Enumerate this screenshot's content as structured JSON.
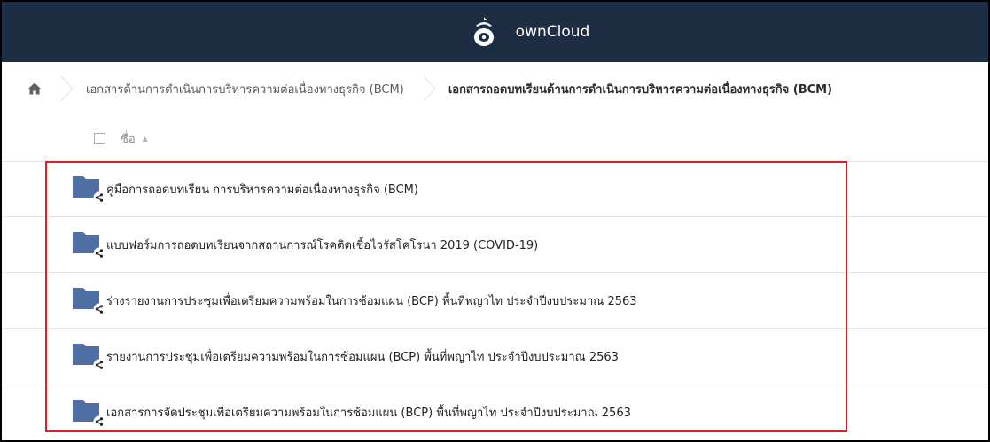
{
  "app": {
    "name": "ownCloud"
  },
  "breadcrumb": {
    "home_icon": "home-icon",
    "items": [
      "เอกสารด้านการดำเนินการบริหารความต่อเนื่องทางธุรกิจ (BCM)",
      "เอกสารถอดบทเรียนด้านการดำเนินการบริหารความต่อเนื่องทางธุรกิจ (BCM)"
    ]
  },
  "file_list": {
    "name_header": "ชื่อ",
    "sort_icon": "sort-ascending-icon",
    "items": [
      {
        "name": "คู่มือการถอดบทเรียน การบริหารความต่อเนื่องทางธุรกิจ (BCM)",
        "icon": "shared-folder-icon"
      },
      {
        "name": "แบบฟอร์มการถอดบทเรียนจากสถานการณ์โรคติดเชื้อไวรัสโคโรนา 2019 (COVID-19)",
        "icon": "shared-folder-icon"
      },
      {
        "name": "ร่างรายงานการประชุมเพื่อเตรียมความพร้อมในการซ้อมแผน (BCP) พื้นที่พญาไท ประจำปีงบประมาณ 2563",
        "icon": "shared-folder-icon"
      },
      {
        "name": "รายงานการประชุมเพื่อเตรียมความพร้อมในการซ้อมแผน (BCP) พื้นที่พญาไท ประจำปีงบประมาณ 2563",
        "icon": "shared-folder-icon"
      },
      {
        "name": "เอกสารการจัดประชุมเพื่อเตรียมความพร้อมในการซ้อมแผน (BCP) พื้นที่พญาไท ประจำปีงบประมาณ 2563",
        "icon": "shared-folder-icon"
      }
    ]
  },
  "colors": {
    "topbar": "#1d2d44",
    "folder": "#4f6ea3",
    "highlight": "#e02020"
  }
}
